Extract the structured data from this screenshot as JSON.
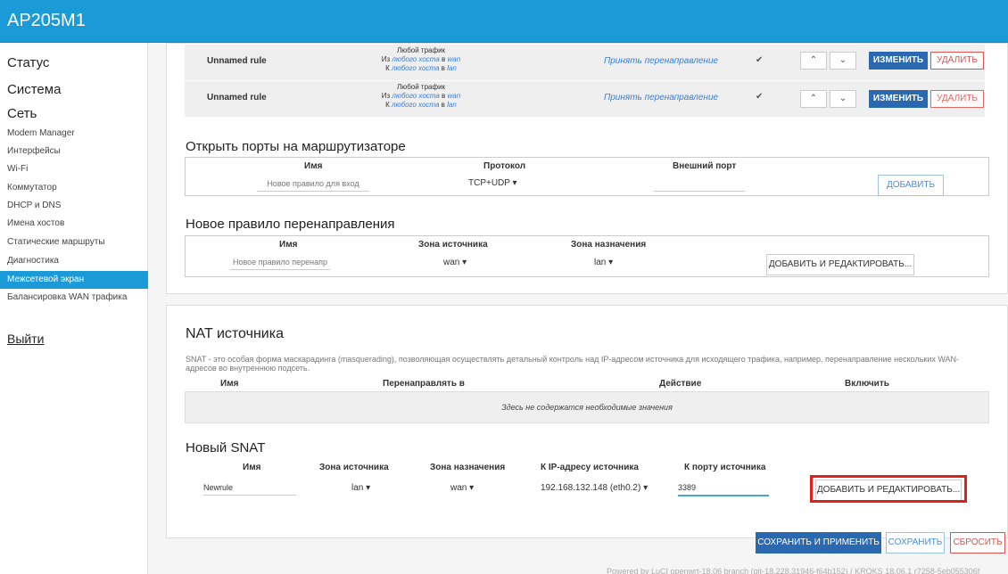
{
  "header": {
    "brand": "AP205M1"
  },
  "sidebar": {
    "top_items": [
      "Статус",
      "Система",
      "Сеть"
    ],
    "sub_items": [
      "Modem Manager",
      "Интерфейсы",
      "Wi-Fi",
      "Коммутатор",
      "DHCP и DNS",
      "Имена хостов",
      "Статические маршруты",
      "Диагностика",
      "Межсетевой экран",
      "Балансировка WAN трафика"
    ],
    "active_index": 8,
    "logout": "Выйти"
  },
  "rules": [
    {
      "name": "Unnamed rule",
      "match_line1": "Любой трафик",
      "match_from_pre": "Из",
      "match_from_host": "любого хоста",
      "match_from_in": "в",
      "match_from_zone": "wan",
      "match_to_pre": "К",
      "match_to_host": "любого хоста",
      "match_to_in": "в",
      "match_to_zone": "lan",
      "action": "Принять перенаправление",
      "checkbox": "✔",
      "up": "⌃",
      "down": "⌄",
      "edit": "ИЗМЕНИТЬ",
      "delete": "УДАЛИТЬ"
    },
    {
      "name": "Unnamed rule",
      "match_line1": "Любой трафик",
      "match_from_pre": "Из",
      "match_from_host": "любого хоста",
      "match_from_in": "в",
      "match_from_zone": "wan",
      "match_to_pre": "К",
      "match_to_host": "любого хоста",
      "match_to_in": "в",
      "match_to_zone": "lan",
      "action": "Принять перенаправление",
      "checkbox": "✔",
      "up": "⌃",
      "down": "⌄",
      "edit": "ИЗМЕНИТЬ",
      "delete": "УДАЛИТЬ"
    }
  ],
  "open_ports": {
    "title": "Открыть порты на маршрутизаторе",
    "col_name": "Имя",
    "col_protocol": "Протокол",
    "col_ext_port": "Внешний порт",
    "name_placeholder": "Новое правило для вход",
    "protocol_value": "TCP+UDP ▾",
    "ext_port_value": "",
    "add_button": "ДОБАВИТЬ"
  },
  "new_redirect": {
    "title": "Новое правило перенаправления",
    "col_name": "Имя",
    "col_src_zone": "Зона источника",
    "col_dst_zone": "Зона назначения",
    "name_placeholder": "Новое правило перенапр",
    "src_zone_value": "wan ▾",
    "dst_zone_value": "lan ▾",
    "add_button": "ДОБАВИТЬ И РЕДАКТИРОВАТЬ..."
  },
  "nat": {
    "title": "NAT источника",
    "description": "SNAT - это особая форма маскарадинга (masquerading), позволяющая осуществлять детальный контроль над IP-адресом источника для исходящего трафика, например, перенаправление нескольких WAN-адресов во внутреннюю подсеть.",
    "col_name": "Имя",
    "col_redirect": "Перенаправлять в",
    "col_action": "Действие",
    "col_enable": "Включить",
    "empty_text": "Здесь не содержатся необходимые значения"
  },
  "new_snat": {
    "title": "Новый SNAT",
    "col_name": "Имя",
    "col_src_zone": "Зона источника",
    "col_dst_zone": "Зона назначения",
    "col_src_ip": "К IP-адресу источника",
    "col_src_port": "К порту источника",
    "name_value": "Newrule",
    "src_zone_value": "lan ▾",
    "dst_zone_value": "wan ▾",
    "src_ip_value": "192.168.132.148 (eth0.2) ▾",
    "src_port_value": "3389",
    "add_button": "ДОБАВИТЬ И РЕДАКТИРОВАТЬ..."
  },
  "actions": {
    "save_apply": "СОХРАНИТЬ И ПРИМЕНИТЬ",
    "save": "СОХРАНИТЬ",
    "reset": "СБРОСИТЬ"
  },
  "footer": "Powered by LuCI openwrt-18.06 branch (git-18.228.31946-f64b152) / KROKS 18.06.1 r7258-5eb055306f",
  "colors": {
    "header": "#1a9bd7",
    "primary_button": "#2a68b0",
    "danger": "#d9534f",
    "highlight": "#e0201c"
  }
}
